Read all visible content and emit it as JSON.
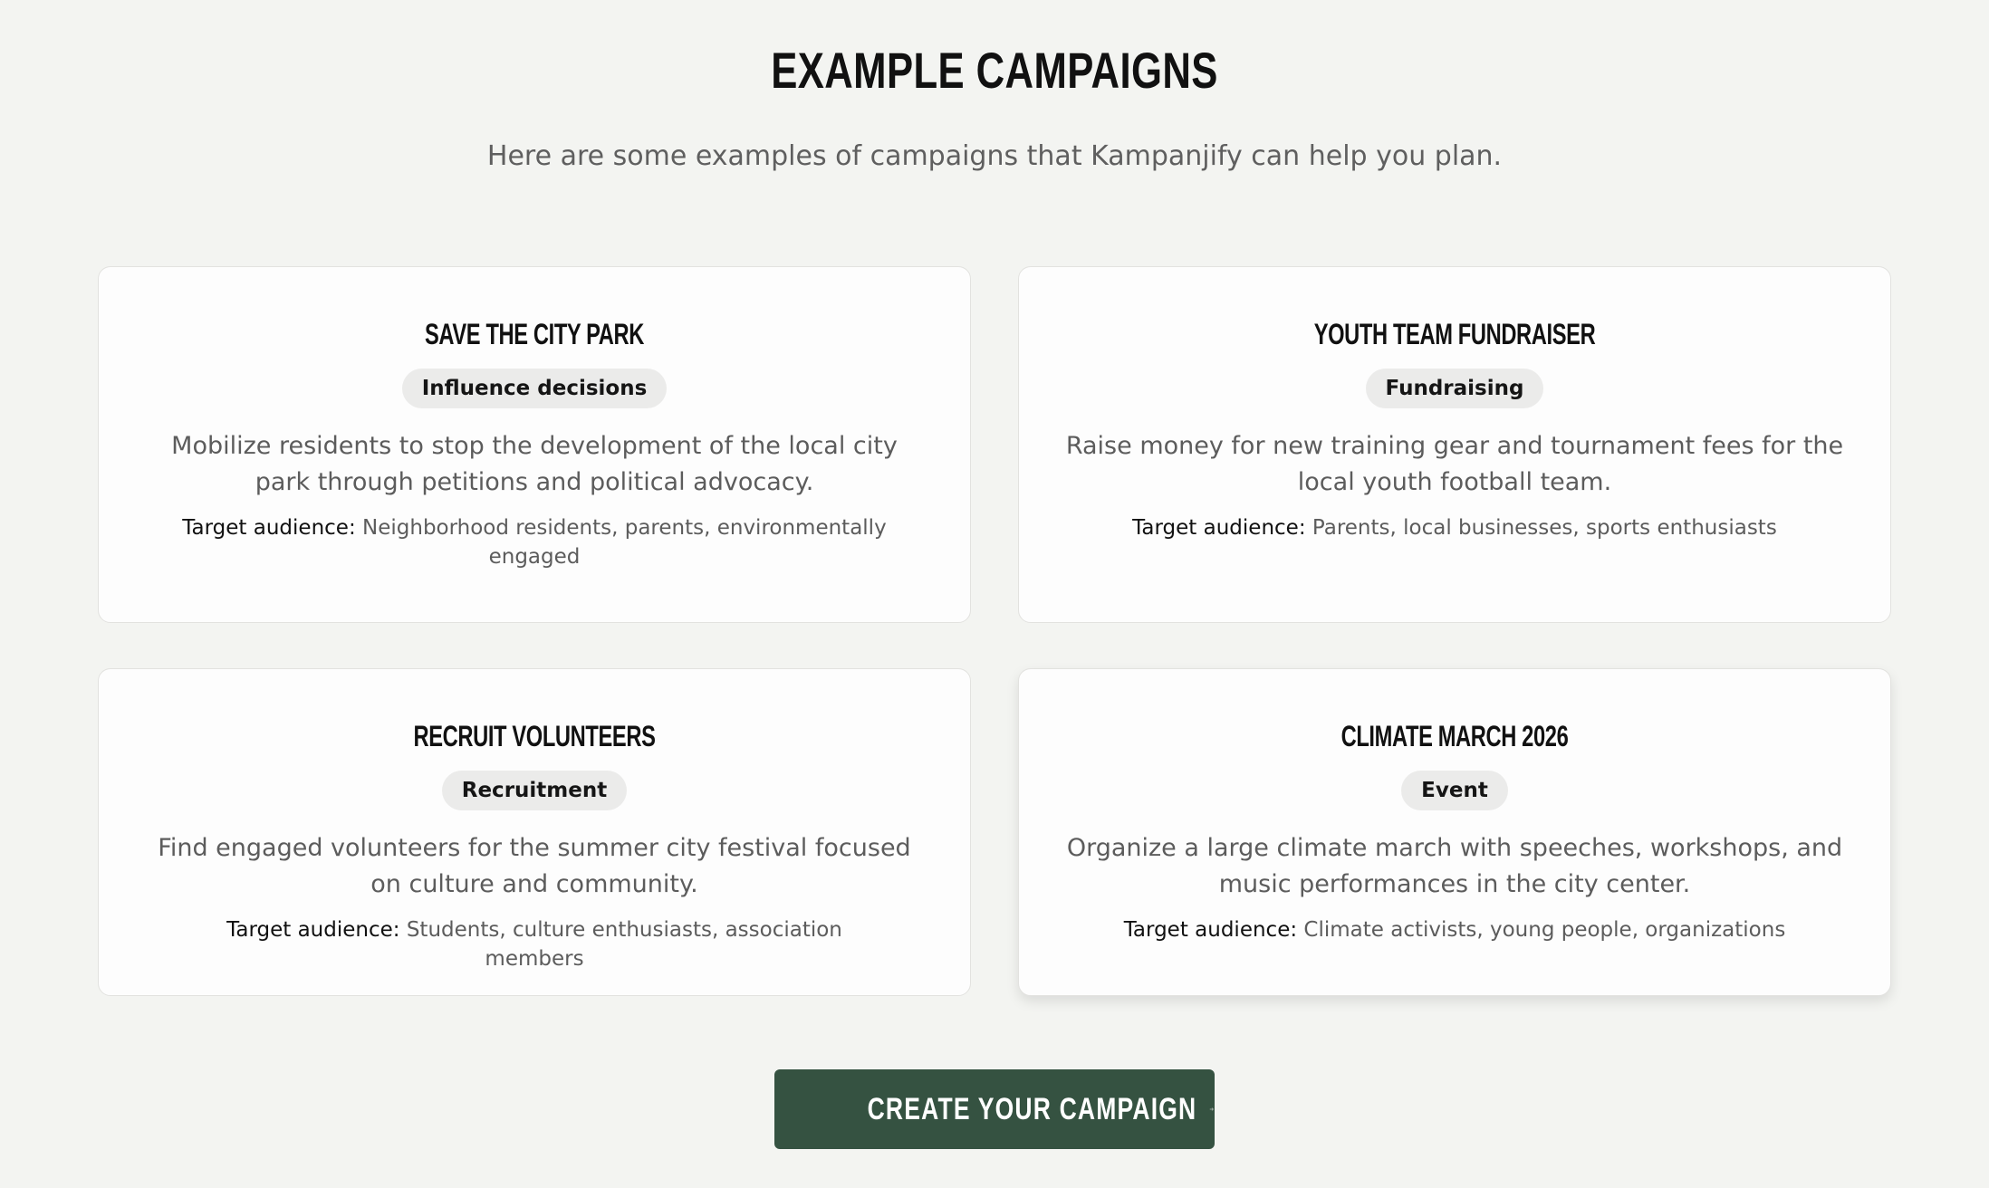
{
  "header": {
    "title": "Example Campaigns",
    "subtitle": "Here are some examples of campaigns that Kampanjify can help you plan."
  },
  "audience_label": "Target audience:",
  "campaigns": [
    {
      "title": "Save the City Park",
      "tag": "Influence decisions",
      "description": "Mobilize residents to stop the development of the local city park through petitions and political advocacy.",
      "audience": "Neighborhood residents, parents, environmentally engaged"
    },
    {
      "title": "Youth Team Fundraiser",
      "tag": "Fundraising",
      "description": "Raise money for new training gear and tournament fees for the local youth football team.",
      "audience": "Parents, local businesses, sports enthusiasts"
    },
    {
      "title": "Recruit Volunteers",
      "tag": "Recruitment",
      "description": "Find engaged volunteers for the summer city festival focused on culture and community.",
      "audience": "Students, culture enthusiasts, association members"
    },
    {
      "title": "Climate March 2026",
      "tag": "Event",
      "description": "Organize a large climate march with speeches, workshops, and music performances in the city center.",
      "audience": "Climate activists, young people, organizations"
    }
  ],
  "cta": {
    "label": "Create your campaign",
    "icon": "arrow-right-icon"
  },
  "colors": {
    "background": "#f3f4f1",
    "card_background": "#fdfdfd",
    "badge_background": "#ebebea",
    "cta_background": "#355241",
    "text_muted": "#5c5c5c"
  }
}
